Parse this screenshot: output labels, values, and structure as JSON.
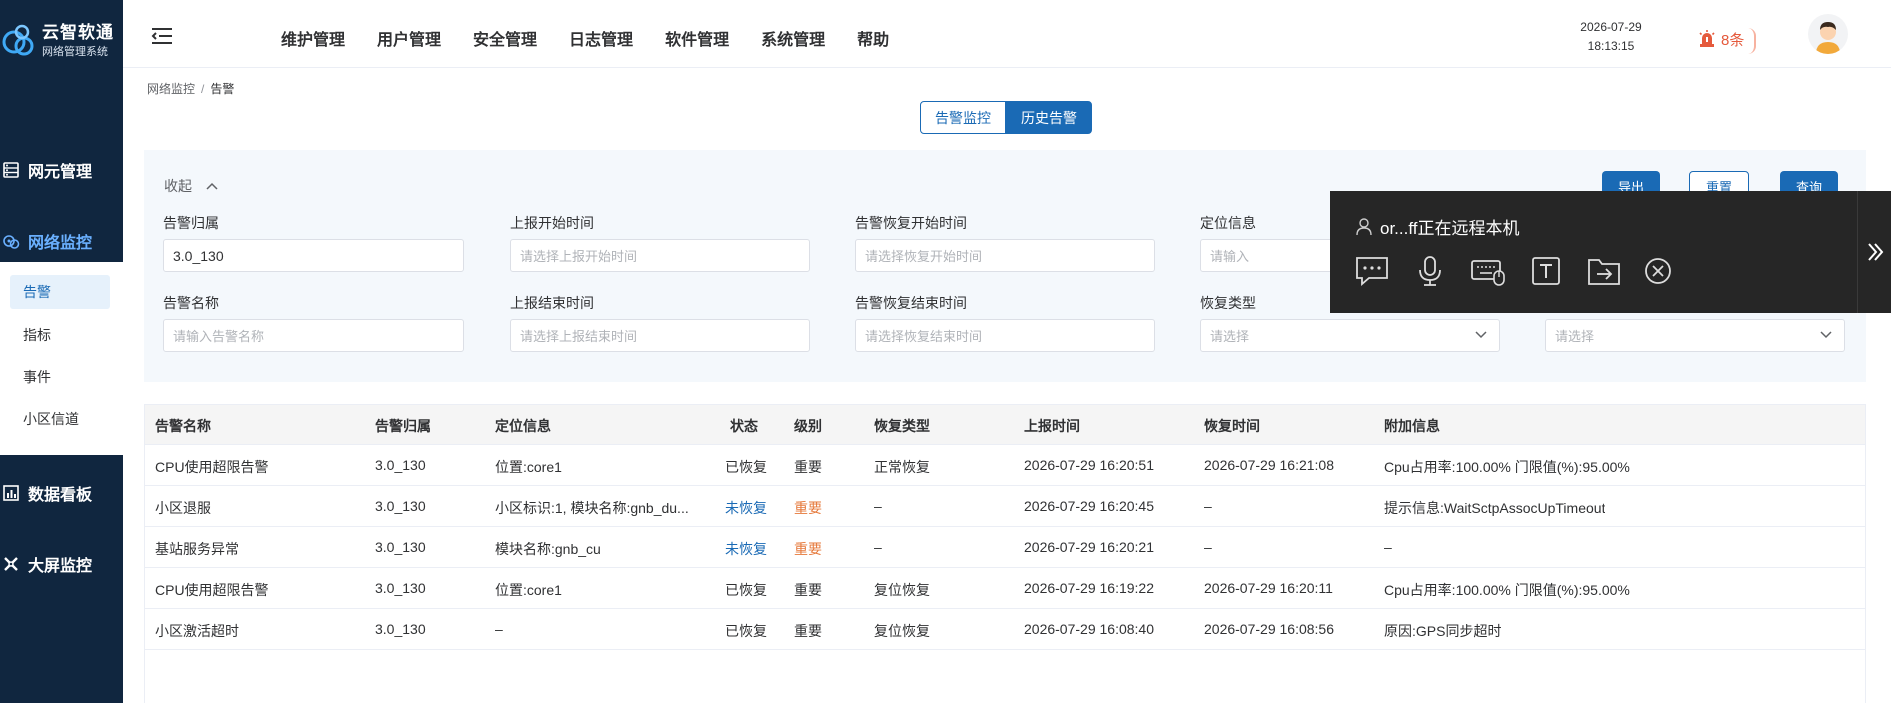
{
  "brand": {
    "name": "云智软通",
    "subtitle": "网络管理系统"
  },
  "sidebar": {
    "items": [
      {
        "label": "网元管理",
        "icon": "server-icon"
      },
      {
        "label": "网络监控",
        "icon": "monitor-icon",
        "active": true
      },
      {
        "label": "数据看板",
        "icon": "chart-icon"
      },
      {
        "label": "大屏监控",
        "icon": "screen-icon"
      }
    ],
    "submenu": [
      {
        "label": "告警",
        "active": true
      },
      {
        "label": "指标"
      },
      {
        "label": "事件"
      },
      {
        "label": "小区信道"
      }
    ]
  },
  "header": {
    "menu": [
      "维护管理",
      "用户管理",
      "安全管理",
      "日志管理",
      "软件管理",
      "系统管理",
      "帮助"
    ],
    "date": "2026-07-29",
    "time": "18:13:15",
    "alarm_count": "8条"
  },
  "breadcrumb": {
    "parent": "网络监控",
    "separator": "/",
    "current": "告警"
  },
  "tabs": {
    "monitor": "告警监控",
    "history": "历史告警",
    "selected": "历史告警"
  },
  "filter": {
    "collapse_label": "收起",
    "buttons": {
      "export": "导出",
      "reset": "重置",
      "query": "查询"
    },
    "fields": {
      "alarm_owner": {
        "label": "告警归属",
        "value": "3.0_130"
      },
      "report_start": {
        "label": "上报开始时间",
        "placeholder": "请选择上报开始时间"
      },
      "recover_start": {
        "label": "告警恢复开始时间",
        "placeholder": "请选择恢复开始时间"
      },
      "location": {
        "label": "定位信息",
        "placeholder": "请输入"
      },
      "alarm_name": {
        "label": "告警名称",
        "placeholder": "请输入告警名称"
      },
      "report_end": {
        "label": "上报结束时间",
        "placeholder": "请选择上报结束时间"
      },
      "recover_end": {
        "label": "告警恢复结束时间",
        "placeholder": "请选择恢复结束时间"
      },
      "recover_type": {
        "label": "恢复类型",
        "placeholder": "请选择"
      },
      "extra_select": {
        "placeholder": "请选择"
      }
    }
  },
  "table": {
    "columns": [
      "告警名称",
      "告警归属",
      "定位信息",
      "状态",
      "级别",
      "恢复类型",
      "上报时间",
      "恢复时间",
      "附加信息"
    ],
    "rows": [
      [
        "CPU使用超限告警",
        "3.0_130",
        "位置:core1",
        "已恢复",
        "重要",
        "正常恢复",
        "2026-07-29 16:20:51",
        "2026-07-29 16:21:08",
        "Cpu占用率:100.00% 门限值(%):95.00%"
      ],
      [
        "小区退服",
        "3.0_130",
        "小区标识:1, 模块名称:gnb_du...",
        "未恢复",
        "重要",
        "–",
        "2026-07-29 16:20:45",
        "–",
        "提示信息:WaitSctpAssocUpTimeout"
      ],
      [
        "基站服务异常",
        "3.0_130",
        "模块名称:gnb_cu",
        "未恢复",
        "重要",
        "–",
        "2026-07-29 16:20:21",
        "–",
        "–"
      ],
      [
        "CPU使用超限告警",
        "3.0_130",
        "位置:core1",
        "已恢复",
        "重要",
        "复位恢复",
        "2026-07-29 16:19:22",
        "2026-07-29 16:20:11",
        "Cpu占用率:100.00% 门限值(%):95.00%"
      ],
      [
        "小区激活超时",
        "3.0_130",
        "–",
        "已恢复",
        "重要",
        "复位恢复",
        "2026-07-29 16:08:40",
        "2026-07-29 16:08:56",
        "原因:GPS同步超时"
      ]
    ]
  },
  "remote": {
    "title": "or...ff正在远程本机",
    "icons": [
      "chat-icon",
      "microphone-icon",
      "keyboard-mouse-icon",
      "text-icon",
      "file-transfer-icon",
      "close-circle-icon",
      "expand-icon"
    ]
  },
  "colors": {
    "primary": "#1a6ab5",
    "sidebar": "#10263f",
    "alarm": "#e55a3c",
    "warning": "#e6793b"
  }
}
